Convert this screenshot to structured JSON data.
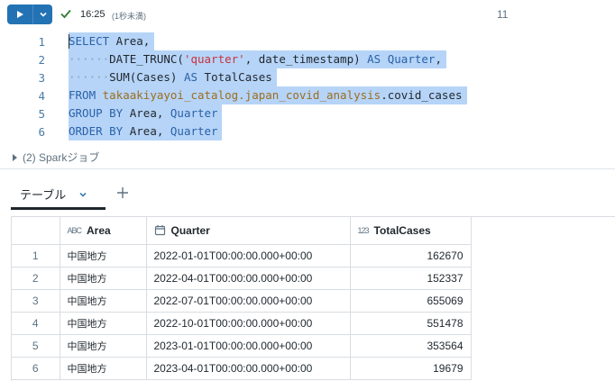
{
  "toolbar": {
    "run_icon": "play-icon",
    "dropdown_icon": "chevron-down-icon",
    "status_icon": "check-icon",
    "status_time": "16:25",
    "status_duration": "(1秒未満)",
    "cell_count": "11",
    "accent_color": "#2272b4",
    "success_color": "#2e7d32"
  },
  "code": {
    "lines": [
      {
        "n": "1",
        "tokens": [
          [
            "kw",
            "SELECT"
          ],
          [
            "ident",
            " Area,"
          ]
        ]
      },
      {
        "n": "2",
        "tokens": [
          [
            "dot",
            "······"
          ],
          [
            "ident",
            "DATE_TRUNC("
          ],
          [
            "str",
            "'quarter'"
          ],
          [
            "ident",
            ", date_timestamp) "
          ],
          [
            "kw",
            "AS"
          ],
          [
            "ident",
            " "
          ],
          [
            "kw",
            "Quarter"
          ],
          [
            "ident",
            ","
          ]
        ]
      },
      {
        "n": "3",
        "tokens": [
          [
            "dot",
            "······"
          ],
          [
            "ident",
            "SUM(Cases) "
          ],
          [
            "kw",
            "AS"
          ],
          [
            "ident",
            " TotalCases"
          ]
        ]
      },
      {
        "n": "4",
        "tokens": [
          [
            "kw",
            "FROM"
          ],
          [
            "ident",
            " "
          ],
          [
            "obj",
            "takaakiyayoi_catalog.japan_covid_analysis"
          ],
          [
            "ident",
            ".covid_cases"
          ]
        ]
      },
      {
        "n": "5",
        "tokens": [
          [
            "kw",
            "GROUP BY"
          ],
          [
            "ident",
            " Area, "
          ],
          [
            "kw",
            "Quarter"
          ]
        ]
      },
      {
        "n": "6",
        "tokens": [
          [
            "kw",
            "ORDER BY"
          ],
          [
            "ident",
            " Area, "
          ],
          [
            "kw",
            "Quarter"
          ]
        ]
      }
    ]
  },
  "spark": {
    "label": "(2) Sparkジョブ"
  },
  "tabs": {
    "table_label": "テーブル",
    "add_icon": "plus-icon"
  },
  "table": {
    "columns": [
      {
        "label": "",
        "type_icon": ""
      },
      {
        "label": "Area",
        "type_icon": "ABC"
      },
      {
        "label": "Quarter",
        "type_icon": "calendar-icon"
      },
      {
        "label": "TotalCases",
        "type_icon": "123"
      }
    ],
    "rows": [
      {
        "idx": "1",
        "area": "中国地方",
        "quarter": "2022-01-01T00:00:00.000+00:00",
        "total": "162670"
      },
      {
        "idx": "2",
        "area": "中国地方",
        "quarter": "2022-04-01T00:00:00.000+00:00",
        "total": "152337"
      },
      {
        "idx": "3",
        "area": "中国地方",
        "quarter": "2022-07-01T00:00:00.000+00:00",
        "total": "655069"
      },
      {
        "idx": "4",
        "area": "中国地方",
        "quarter": "2022-10-01T00:00:00.000+00:00",
        "total": "551478"
      },
      {
        "idx": "5",
        "area": "中国地方",
        "quarter": "2023-01-01T00:00:00.000+00:00",
        "total": "353564"
      },
      {
        "idx": "6",
        "area": "中国地方",
        "quarter": "2023-04-01T00:00:00.000+00:00",
        "total": "19679"
      }
    ]
  }
}
